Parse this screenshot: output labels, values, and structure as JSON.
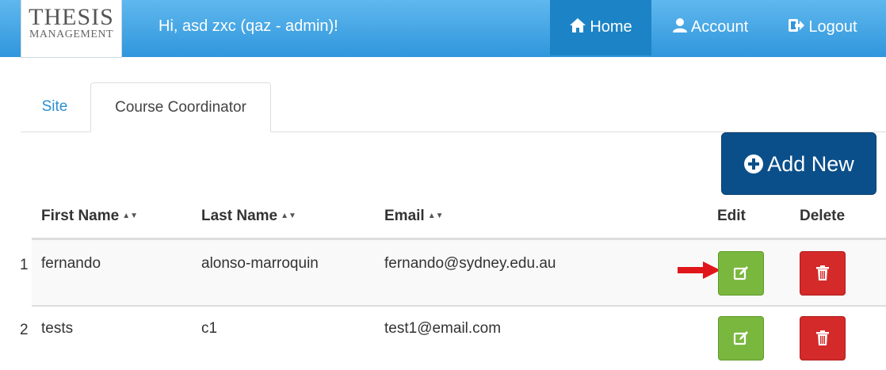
{
  "brand": {
    "line1": "THESIS",
    "line2": "MANAGEMENT"
  },
  "header": {
    "greeting": "Hi, asd zxc (qaz - admin)!"
  },
  "nav": [
    {
      "label": "Home",
      "icon": "home-icon",
      "active": true
    },
    {
      "label": "Account",
      "icon": "user-icon",
      "active": false
    },
    {
      "label": "Logout",
      "icon": "logout-icon",
      "active": false
    }
  ],
  "tabs": [
    {
      "label": "Site",
      "active": false
    },
    {
      "label": "Course Coordinator",
      "active": true
    }
  ],
  "actions": {
    "add_new": "Add New"
  },
  "table": {
    "columns": [
      {
        "label": "First Name",
        "sortable": true
      },
      {
        "label": "Last Name",
        "sortable": true
      },
      {
        "label": "Email",
        "sortable": true
      },
      {
        "label": "Edit",
        "sortable": false
      },
      {
        "label": "Delete",
        "sortable": false
      }
    ],
    "sort_glyph": "▲▼",
    "rows": [
      {
        "index": "1",
        "first_name": "fernando",
        "last_name": "alonso-marroquin",
        "email": "fernando@sydney.edu.au"
      },
      {
        "index": "2",
        "first_name": "tests",
        "last_name": "c1",
        "email": "test1@email.com"
      }
    ]
  },
  "colors": {
    "navbar": "#3b9fe3",
    "active_nav": "#1c84c6",
    "add_button": "#0b4f8a",
    "edit": "#7ab73e",
    "delete": "#d42a2a",
    "annotation_arrow": "#e0161b"
  }
}
